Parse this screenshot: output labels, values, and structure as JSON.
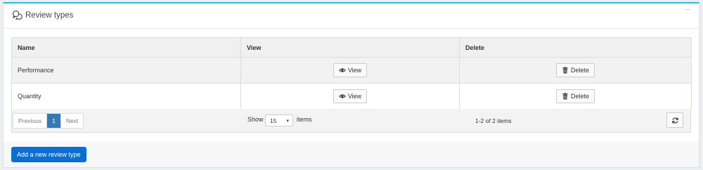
{
  "panel": {
    "title": "Review types",
    "title_icon": "chat-bubbles-icon",
    "accent_color": "#2bbbd8"
  },
  "table": {
    "headers": [
      "Name",
      "View",
      "Delete"
    ],
    "rows": [
      {
        "name": "Performance",
        "view_label": "View",
        "delete_label": "Delete"
      },
      {
        "name": "Quantity",
        "view_label": "View",
        "delete_label": "Delete"
      }
    ]
  },
  "pager": {
    "previous": "Previous",
    "current_page": "1",
    "next": "Next",
    "show_label": "Show",
    "page_size": "15",
    "items_label": "items",
    "count_text": "1-2 of 2 items"
  },
  "actions": {
    "add_label": "Add a new review type",
    "add_color": "#0a6fd1"
  }
}
